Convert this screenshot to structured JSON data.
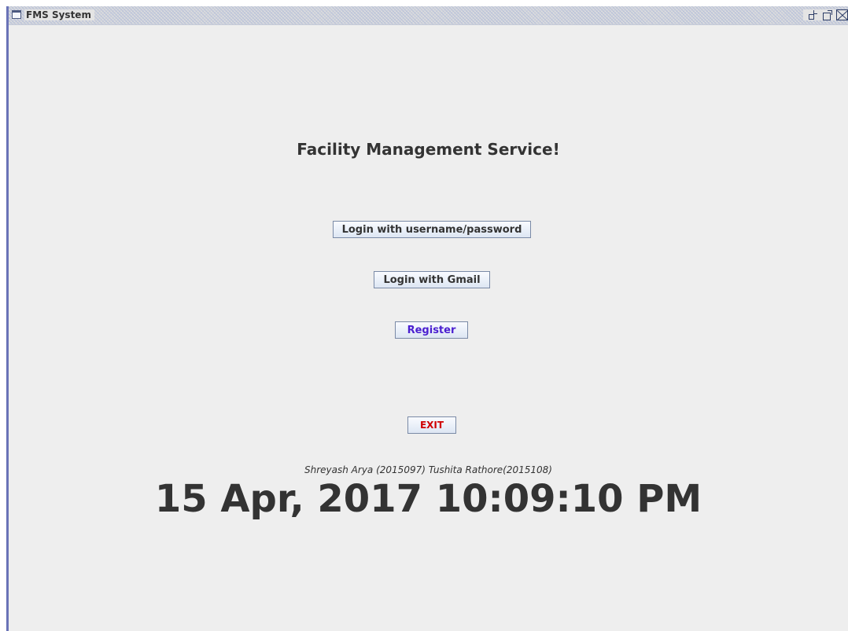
{
  "window": {
    "title": "FMS System",
    "controls": [
      "iconify-icon",
      "maximize-icon",
      "close-icon"
    ]
  },
  "main": {
    "heading": "Facility Management Service!",
    "buttons": {
      "login_username": "Login with username/password",
      "login_gmail": "Login with Gmail",
      "register": "Register",
      "exit": "EXIT"
    },
    "authors": "Shreyash Arya (2015097) Tushita Rathore(2015108)",
    "clock": "15 Apr, 2017 10:09:10 PM"
  },
  "colors": {
    "background": "#eeeeee",
    "text": "#333333",
    "register_text": "#4a1fd0",
    "exit_text": "#d00000",
    "window_border": "#6a73b7"
  }
}
